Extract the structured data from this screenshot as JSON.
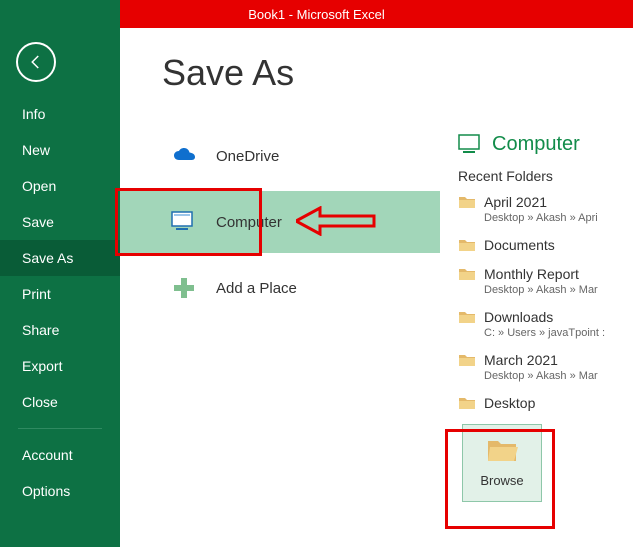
{
  "titlebar": {
    "title": "Book1 -  Microsoft Excel"
  },
  "sidebar": {
    "items": [
      {
        "label": "Info"
      },
      {
        "label": "New"
      },
      {
        "label": "Open"
      },
      {
        "label": "Save"
      },
      {
        "label": "Save As"
      },
      {
        "label": "Print"
      },
      {
        "label": "Share"
      },
      {
        "label": "Export"
      },
      {
        "label": "Close"
      }
    ],
    "bottom": [
      {
        "label": "Account"
      },
      {
        "label": "Options"
      }
    ]
  },
  "page": {
    "title": "Save As"
  },
  "places": [
    {
      "label": "OneDrive"
    },
    {
      "label": "Computer"
    },
    {
      "label": "Add a Place"
    }
  ],
  "right": {
    "title": "Computer",
    "recent_label": "Recent Folders",
    "folders": [
      {
        "label": "April 2021",
        "path": "Desktop » Akash » Apri"
      },
      {
        "label": "Documents",
        "path": ""
      },
      {
        "label": "Monthly Report",
        "path": "Desktop » Akash » Mar"
      },
      {
        "label": "Downloads",
        "path": "C: » Users » javaTpoint :"
      },
      {
        "label": "March 2021",
        "path": "Desktop » Akash » Mar"
      },
      {
        "label": "Desktop",
        "path": ""
      }
    ],
    "browse_label": "Browse"
  },
  "annotations": {
    "highlight_color": "#a2d6b9",
    "red": "#e60000"
  }
}
